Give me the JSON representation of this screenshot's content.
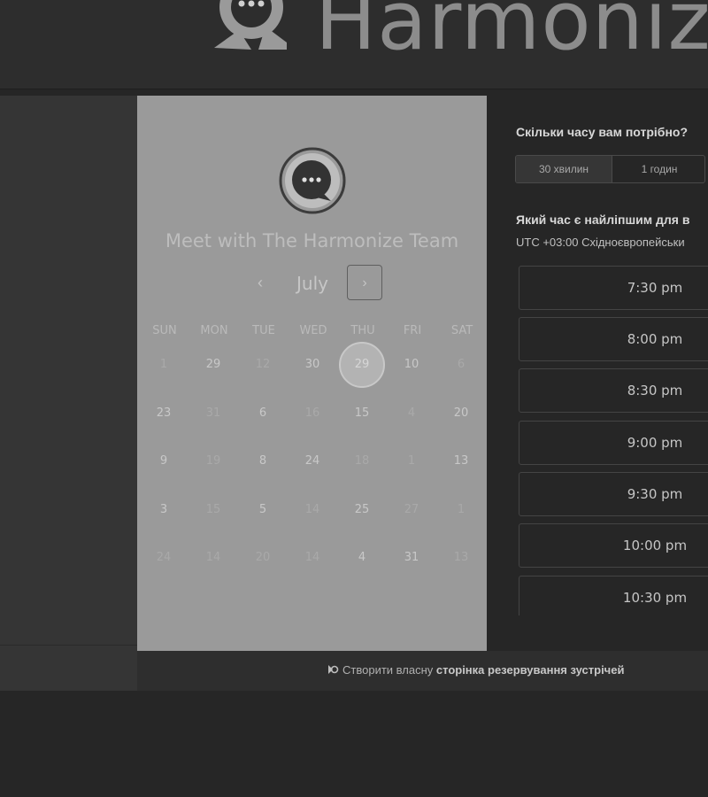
{
  "header": {
    "brand": "Harmonize"
  },
  "calendar": {
    "title": "Meet with The Harmonize Team",
    "month": "July",
    "prev_glyph": "‹",
    "next_glyph": "›",
    "weekdays": [
      "SUN",
      "MON",
      "TUE",
      "WED",
      "THU",
      "FRI",
      "SAT"
    ],
    "weeks": [
      [
        {
          "d": "1",
          "on": false
        },
        {
          "d": "29",
          "on": true
        },
        {
          "d": "12",
          "on": false
        },
        {
          "d": "30",
          "on": true
        },
        {
          "d": "29",
          "on": true,
          "sel": true
        },
        {
          "d": "10",
          "on": true
        },
        {
          "d": "6",
          "on": false
        }
      ],
      [
        {
          "d": "23",
          "on": true
        },
        {
          "d": "31",
          "on": false
        },
        {
          "d": "6",
          "on": true
        },
        {
          "d": "16",
          "on": false
        },
        {
          "d": "15",
          "on": true
        },
        {
          "d": "4",
          "on": false
        },
        {
          "d": "20",
          "on": true
        }
      ],
      [
        {
          "d": "9",
          "on": true
        },
        {
          "d": "19",
          "on": false
        },
        {
          "d": "8",
          "on": true
        },
        {
          "d": "24",
          "on": true
        },
        {
          "d": "18",
          "on": false
        },
        {
          "d": "1",
          "on": false
        },
        {
          "d": "13",
          "on": true
        }
      ],
      [
        {
          "d": "3",
          "on": true
        },
        {
          "d": "15",
          "on": false
        },
        {
          "d": "5",
          "on": true
        },
        {
          "d": "14",
          "on": false
        },
        {
          "d": "25",
          "on": true
        },
        {
          "d": "27",
          "on": false
        },
        {
          "d": "1",
          "on": false
        }
      ],
      [
        {
          "d": "24",
          "on": false
        },
        {
          "d": "14",
          "on": false
        },
        {
          "d": "20",
          "on": false
        },
        {
          "d": "14",
          "on": false
        },
        {
          "d": "4",
          "on": true
        },
        {
          "d": "31",
          "on": true
        },
        {
          "d": "13",
          "on": false
        }
      ]
    ]
  },
  "scheduler": {
    "duration_question": "Скільки часу вам потрібно?",
    "durations": [
      {
        "label": "30 хвилин",
        "active": true
      },
      {
        "label": "1 годин",
        "active": false
      }
    ],
    "time_question": "Який час є найліпшим для в",
    "timezone": "UTC +03:00 Східноєвропейськи",
    "slots": [
      "7:30 pm",
      "8:00 pm",
      "8:30 pm",
      "9:00 pm",
      "9:30 pm",
      "10:00 pm",
      "10:30 pm"
    ]
  },
  "footer": {
    "prefix": "Створити власну",
    "link": "сторінка резервування зустрічей"
  },
  "colors": {
    "calendar_panel": "#9a9a9a",
    "page_background": "#262626",
    "accent_text": "#d8d8d8"
  }
}
